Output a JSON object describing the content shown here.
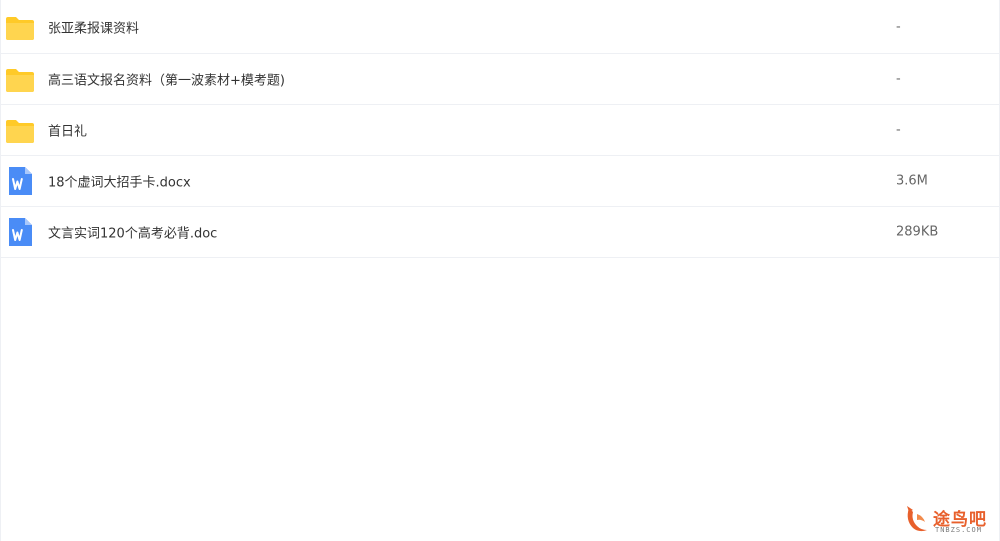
{
  "files": [
    {
      "name": "张亚柔报课资料",
      "size": "-",
      "icon": "folder-icon"
    },
    {
      "name": "高三语文报名资料（第一波素材+模考题)",
      "size": "-",
      "icon": "folder-icon"
    },
    {
      "name": "首日礼",
      "size": "-",
      "icon": "folder-icon"
    },
    {
      "name": "18个虚词大招手卡.docx",
      "size": "3.6M",
      "icon": "word-doc-icon"
    },
    {
      "name": "文言实词120个高考必背.doc",
      "size": "289KB",
      "icon": "word-doc-icon"
    }
  ],
  "watermark": {
    "text": "途鸟吧",
    "sub": "TNBZS.COM"
  },
  "colors": {
    "folder": "#ffca28",
    "word": "#4a8cf6",
    "watermark": "#e8602c"
  }
}
